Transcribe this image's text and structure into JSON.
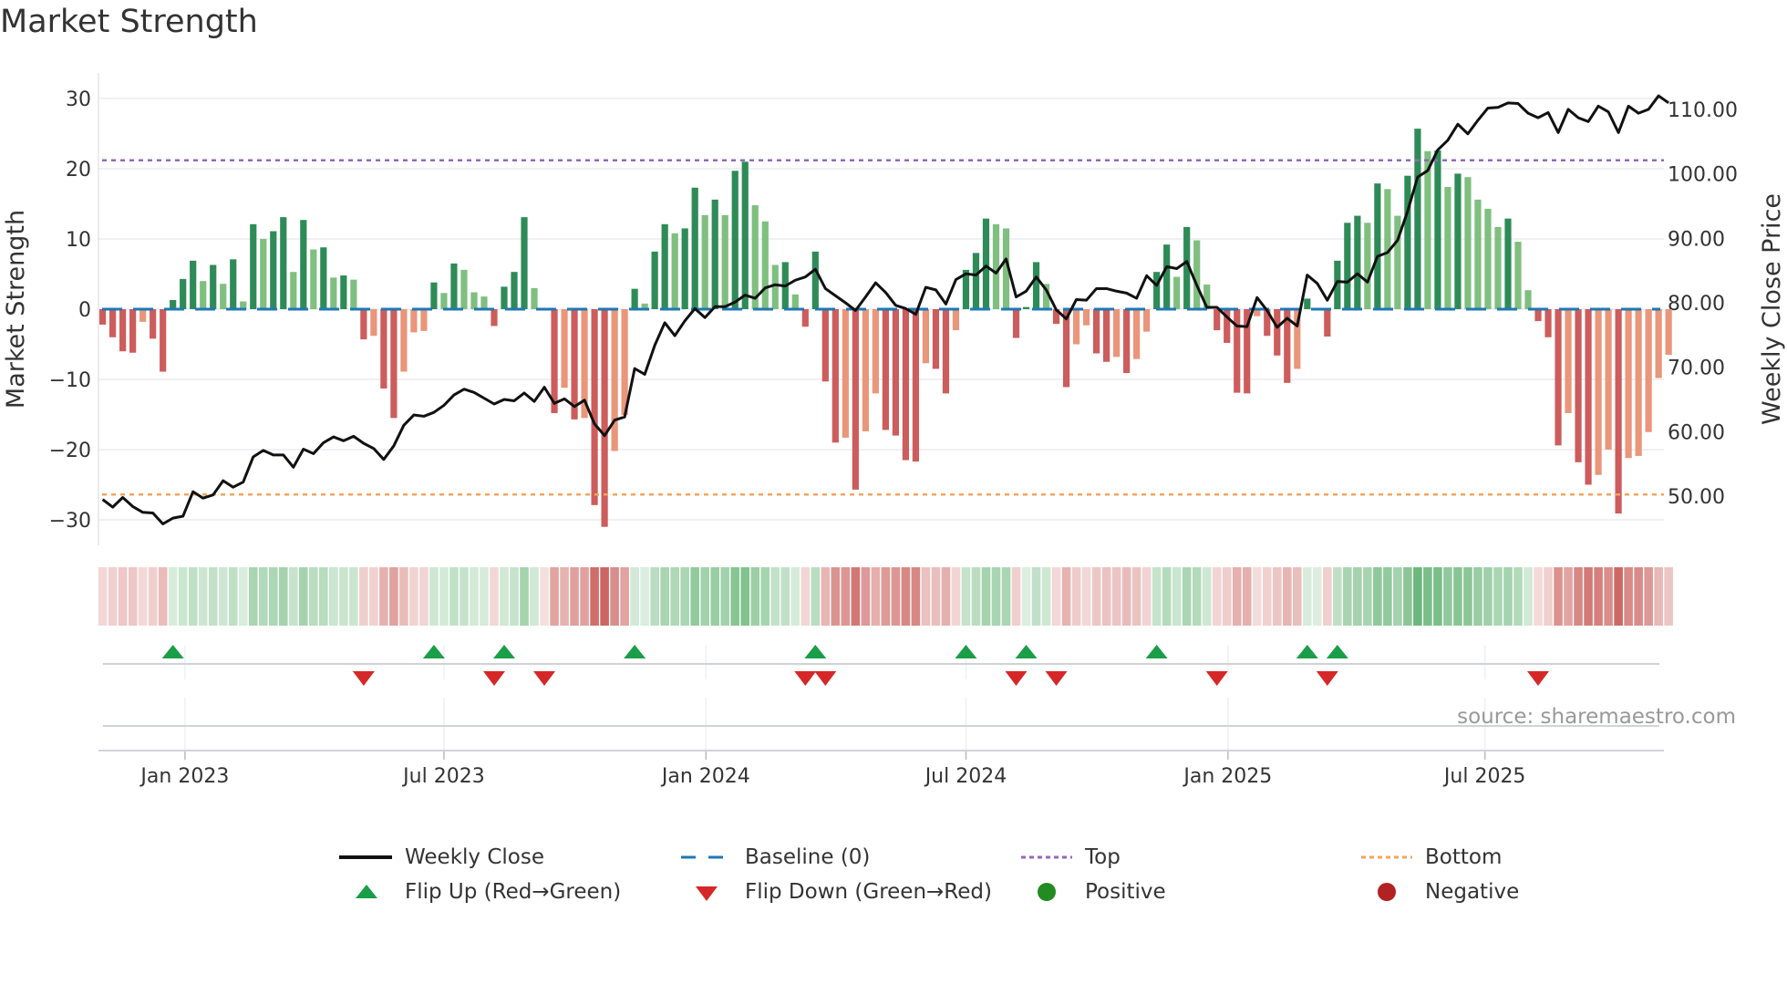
{
  "chart_data": {
    "type": "bar",
    "title": "Market Strength",
    "ylabel": "Market Strength",
    "y2label": "Weekly Close Price",
    "ylim": [
      -33,
      33
    ],
    "y2lim": [
      44.4,
      114.7
    ],
    "yticks": [
      "30",
      "20",
      "10",
      "0",
      "−10",
      "−20",
      "−30"
    ],
    "ytick_values": [
      30,
      20,
      10,
      0,
      -10,
      -20,
      -30
    ],
    "y2ticks": [
      "110.00",
      "100.00",
      "90.00",
      "80.00",
      "70.00",
      "60.00",
      "50.00"
    ],
    "y2tick_values": [
      110,
      100,
      90,
      80,
      70,
      60,
      50
    ],
    "x_ticks": [
      {
        "label": "Jan 2023",
        "week": 8.2
      },
      {
        "label": "Jul 2023",
        "week": 34
      },
      {
        "label": "Jan 2024",
        "week": 60.1
      },
      {
        "label": "Jul 2024",
        "week": 86
      },
      {
        "label": "Jan 2025",
        "week": 112.1
      },
      {
        "label": "Jul 2025",
        "week": 137.7
      }
    ],
    "top_level": 21.2,
    "bottom_level": -26.4,
    "strength": [
      -2.2,
      -4.0,
      -6.0,
      -6.2,
      -1.8,
      -4.2,
      -8.9,
      1.3,
      4.3,
      6.9,
      4.0,
      6.3,
      3.6,
      7.1,
      1.1,
      12.1,
      10.0,
      11.1,
      13.1,
      5.3,
      12.7,
      8.5,
      8.8,
      4.5,
      4.8,
      4.2,
      -4.3,
      -3.8,
      -11.3,
      -15.5,
      -8.9,
      -3.3,
      -3.1,
      3.8,
      2.3,
      6.5,
      5.6,
      2.4,
      1.8,
      -2.4,
      3.2,
      5.3,
      13.1,
      3.0,
      -0.2,
      -14.8,
      -11.2,
      -15.7,
      -15.5,
      -27.9,
      -31.0,
      -20.2,
      -15.1,
      2.9,
      0.8,
      8.2,
      12.1,
      10.8,
      11.5,
      17.3,
      13.4,
      15.6,
      13.4,
      19.7,
      21.0,
      14.8,
      12.5,
      6.3,
      6.7,
      2.1,
      -2.5,
      8.2,
      -10.3,
      -19.0,
      -18.3,
      -25.7,
      -17.4,
      -12.0,
      -17.2,
      -18.0,
      -21.5,
      -21.7,
      -7.7,
      -8.5,
      -12.0,
      -3.0,
      5.6,
      8.0,
      12.9,
      12.1,
      11.5,
      -4.1,
      0.3,
      6.7,
      3.6,
      -2.1,
      -11.1,
      -5.0,
      -2.3,
      -6.3,
      -7.5,
      -6.8,
      -9.1,
      -7.1,
      -3.2,
      5.3,
      9.2,
      4.6,
      11.7,
      9.8,
      3.5,
      -3.0,
      -4.8,
      -11.9,
      -12.0,
      -1.0,
      -3.8,
      -6.6,
      -10.5,
      -8.5,
      1.5,
      0.2,
      -3.9,
      6.9,
      12.3,
      13.3,
      12.3,
      17.9,
      17.1,
      13.3,
      19.0,
      25.7,
      22.5,
      22.6,
      17.4,
      19.3,
      18.8,
      15.6,
      14.3,
      11.7,
      12.9,
      9.6,
      2.7,
      -1.7,
      -4.0,
      -19.4,
      -14.8,
      -21.8,
      -25.0,
      -23.6,
      -20.0,
      -29.1,
      -21.2,
      -20.9,
      -17.5,
      -9.8,
      -6.5
    ],
    "weekly_close": [
      49.5,
      48.3,
      49.8,
      48.4,
      47.5,
      47.4,
      45.7,
      46.6,
      46.9,
      50.7,
      49.7,
      50.2,
      52.4,
      51.4,
      52.2,
      56.1,
      57.1,
      56.4,
      56.4,
      54.5,
      57.3,
      56.6,
      58.3,
      59.2,
      58.6,
      59.3,
      58.2,
      57.4,
      55.7,
      57.8,
      61.0,
      62.6,
      62.4,
      63.0,
      64.1,
      65.7,
      66.6,
      66.1,
      65.2,
      64.3,
      65.0,
      64.8,
      66.0,
      64.7,
      66.9,
      64.4,
      65.1,
      63.9,
      64.9,
      61.2,
      59.4,
      61.8,
      62.3,
      69.8,
      68.9,
      73.4,
      76.9,
      74.9,
      77.2,
      79.1,
      77.7,
      79.4,
      79.4,
      80.1,
      81.2,
      80.7,
      82.3,
      82.8,
      82.6,
      83.5,
      84.0,
      85.2,
      82.2,
      81.1,
      80.0,
      78.8,
      80.9,
      83.1,
      81.6,
      79.6,
      79.1,
      78.2,
      82.4,
      82.0,
      79.8,
      83.6,
      84.5,
      84.3,
      85.7,
      84.6,
      86.8,
      80.9,
      81.8,
      84.0,
      82.0,
      78.9,
      77.5,
      80.5,
      80.4,
      82.2,
      82.2,
      81.8,
      81.5,
      80.7,
      84.2,
      82.7,
      85.6,
      85.3,
      86.4,
      82.7,
      79.3,
      79.3,
      77.8,
      76.4,
      76.3,
      80.8,
      78.8,
      76.2,
      77.6,
      76.4,
      84.3,
      83.0,
      80.4,
      83.3,
      83.2,
      84.5,
      83.2,
      87.2,
      87.8,
      89.7,
      94.2,
      99.5,
      100.5,
      103.7,
      105.2,
      107.7,
      106.2,
      108.3,
      110.2,
      110.3,
      111.0,
      110.9,
      109.4,
      108.7,
      109.5,
      106.4,
      110.0,
      108.7,
      108.1,
      110.5,
      109.6,
      106.4,
      110.5,
      109.4,
      110.0,
      112.1,
      111.0
    ],
    "legend": [
      {
        "label": "Weekly Close",
        "kind": "line",
        "color": "#111111"
      },
      {
        "label": "Baseline (0)",
        "kind": "dashed",
        "color": "#1f77b4"
      },
      {
        "label": "Top",
        "kind": "dotted",
        "color": "#9467bd"
      },
      {
        "label": "Bottom",
        "kind": "dotted",
        "color": "#f4a460"
      },
      {
        "label": "Flip Up (Red→Green)",
        "kind": "triangle-up",
        "color": "#1a9e48"
      },
      {
        "label": "Flip Down (Green→Red)",
        "kind": "triangle-down",
        "color": "#d62728"
      },
      {
        "label": "Positive",
        "kind": "circle",
        "color": "#228b22"
      },
      {
        "label": "Negative",
        "kind": "circle",
        "color": "#b22222"
      }
    ],
    "legend_placement": "bottom",
    "source": "source: sharemaestro.com",
    "grid": true
  },
  "colors": {
    "pos_strong": "#2e8b57",
    "pos_weak": "#7fbf7f",
    "neg_strong": "#cd5c5c",
    "neg_weak": "#e9967a"
  }
}
